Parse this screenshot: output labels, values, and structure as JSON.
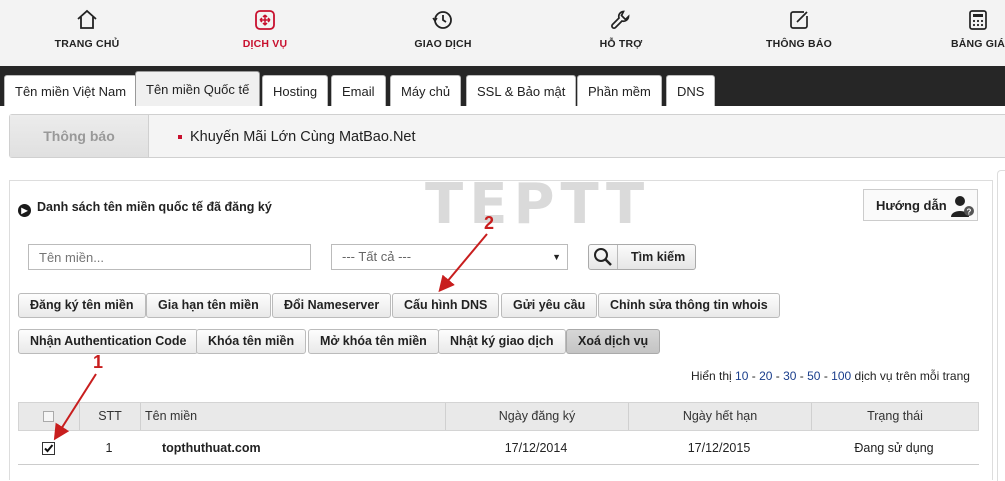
{
  "top_nav": [
    {
      "label": "TRANG CHỦ",
      "icon": "home-icon"
    },
    {
      "label": "DỊCH VỤ",
      "icon": "services-icon",
      "active": true
    },
    {
      "label": "GIAO DỊCH",
      "icon": "transaction-icon"
    },
    {
      "label": "HỖ TRỢ",
      "icon": "wrench-icon"
    },
    {
      "label": "THÔNG BÁO",
      "icon": "edit-icon"
    },
    {
      "label": "BẢNG GIÁ",
      "icon": "calculator-icon"
    }
  ],
  "tabs": [
    {
      "label": "Tên miền Việt Nam"
    },
    {
      "label": "Tên miền Quốc tế",
      "active": true
    },
    {
      "label": "Hosting"
    },
    {
      "label": "Email"
    },
    {
      "label": "Máy chủ"
    },
    {
      "label": "SSL & Bảo mật"
    },
    {
      "label": "Phần mềm"
    },
    {
      "label": "DNS"
    }
  ],
  "notice": {
    "title": "Thông báo",
    "text": "Khuyến Mãi Lớn Cùng MatBao.Net"
  },
  "panel": {
    "title": "Danh sách tên miền quốc tế đã đăng ký",
    "guide_label": "Hướng dẫn",
    "watermark": "TEPTT"
  },
  "search": {
    "domain_placeholder": "Tên miền...",
    "filter_value": "--- Tất cả ---",
    "button_label": "Tìm kiếm"
  },
  "actions_row1": [
    "Đăng ký tên miền",
    "Gia hạn tên miền",
    "Đổi Nameserver",
    "Cấu hình DNS",
    "Gửi yêu cầu",
    "Chỉnh sửa thông tin whois"
  ],
  "actions_row2": [
    "Nhận Authentication Code",
    "Khóa tên miền",
    "Mở khóa tên miền",
    "Nhật ký giao dịch",
    "Xoá dịch vụ"
  ],
  "pager": {
    "prefix": "Hiển thị",
    "n1": "10",
    "n2": "20",
    "n3": "30",
    "n4": "50",
    "n5": "100",
    "sep": " - ",
    "suffix": "dịch vụ trên mỗi trang"
  },
  "table": {
    "headers": {
      "stt": "STT",
      "domain": "Tên miền",
      "reg_date": "Ngày đăng ký",
      "exp_date": "Ngày hết hạn",
      "status": "Trạng thái"
    },
    "rows": [
      {
        "checked": true,
        "stt": "1",
        "domain": "topthuthuat.com",
        "reg_date": "17/12/2014",
        "exp_date": "17/12/2015",
        "status": "Đang sử dụng"
      }
    ]
  },
  "annotations": {
    "one": "1",
    "two": "2"
  },
  "colors": {
    "accent": "#c8102e",
    "tabbar": "#262626",
    "annotation": "#c81e1e"
  }
}
